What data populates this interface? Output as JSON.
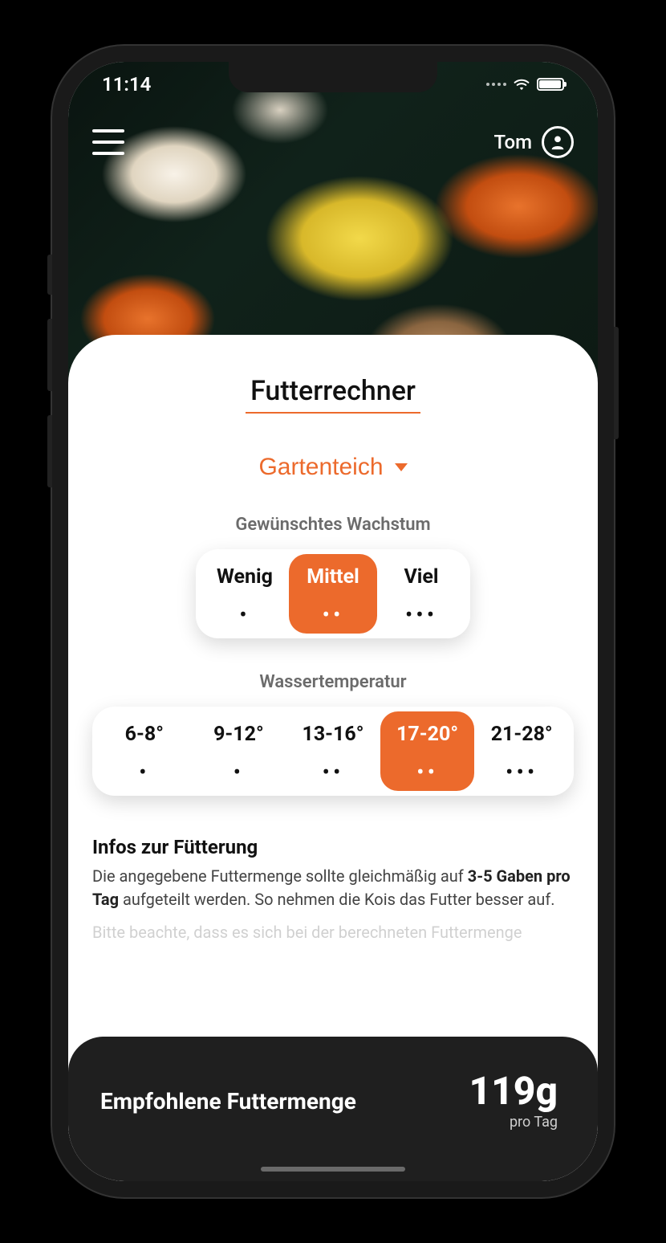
{
  "status": {
    "time": "11:14"
  },
  "user": {
    "name": "Tom"
  },
  "page": {
    "title": "Futterrechner"
  },
  "pond": {
    "selected": "Gartenteich"
  },
  "growth": {
    "label": "Gewünschtes Wachstum",
    "options": [
      "Wenig",
      "Mittel",
      "Viel"
    ],
    "dots": [
      "•",
      "••",
      "•••"
    ],
    "selected_index": 1
  },
  "temperature": {
    "label": "Wassertemperatur",
    "options": [
      "6-8°",
      "9-12°",
      "13-16°",
      "17-20°",
      "21-28°"
    ],
    "dots": [
      "•",
      "•",
      "••",
      "••",
      "•••"
    ],
    "selected_index": 3
  },
  "info": {
    "title": "Infos zur Fütterung",
    "text_pre": "Die angegebene Futtermenge sollte gleichmäßig auf ",
    "text_bold": "3-5 Gaben pro Tag",
    "text_post": " aufgeteilt werden. So nehmen die Kois das Futter besser auf.",
    "text2": "Bitte beachte, dass es sich bei der berechneten Futtermenge"
  },
  "result": {
    "label": "Empfohlene Futtermenge",
    "value": "119g",
    "unit": "pro Tag"
  }
}
